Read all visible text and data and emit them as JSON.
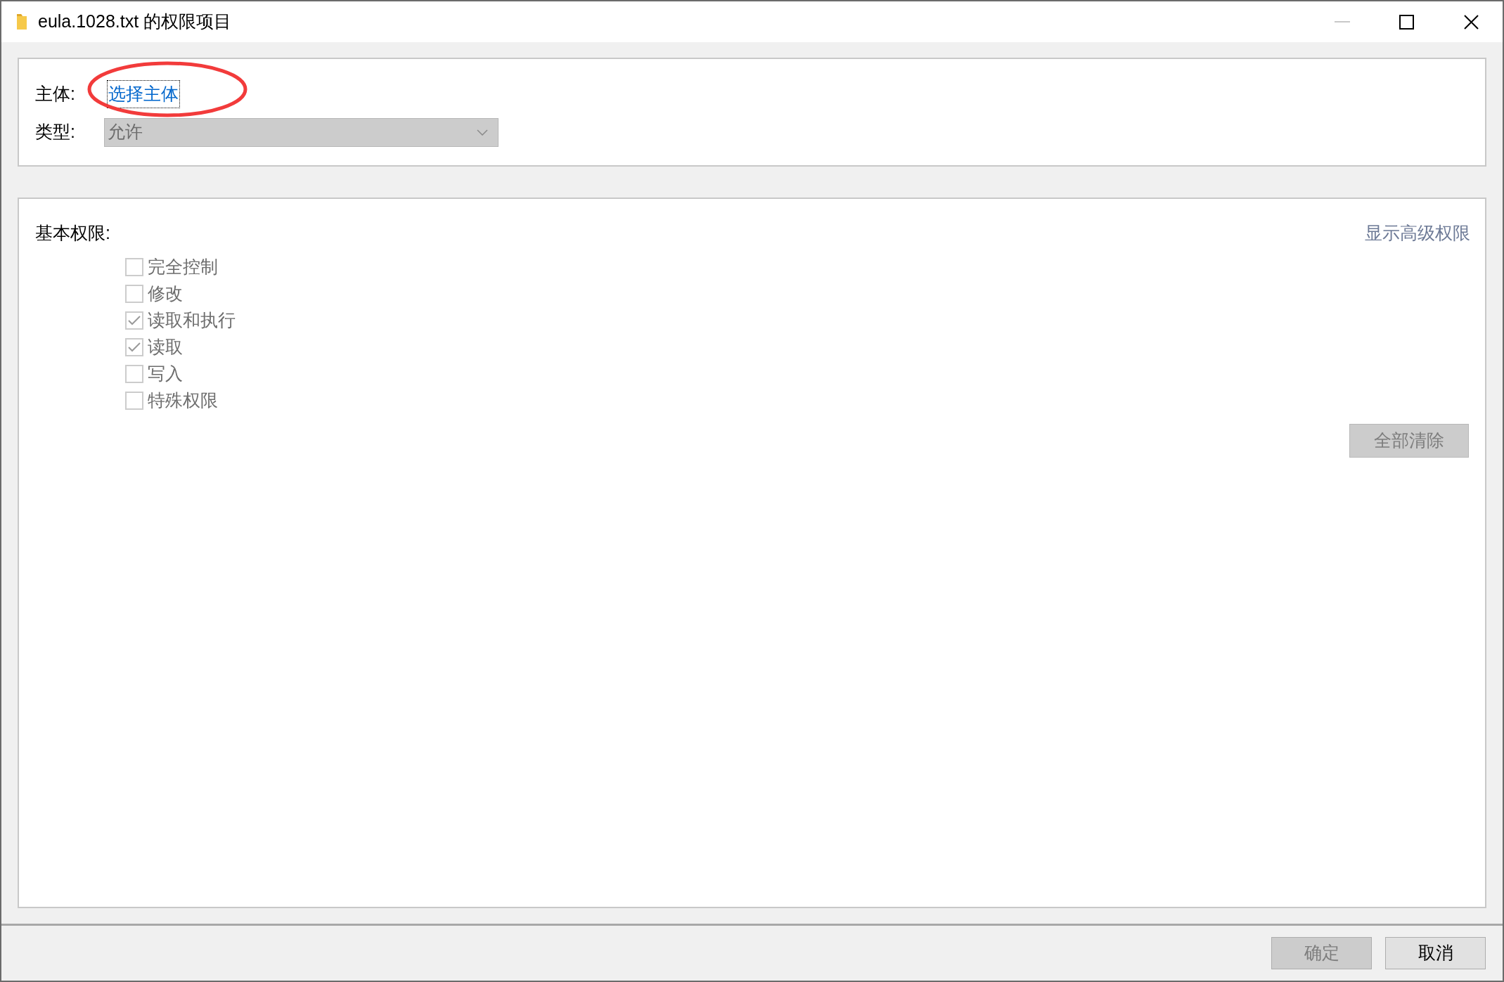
{
  "window": {
    "title": "eula.1028.txt 的权限项目"
  },
  "principal": {
    "label": "主体:",
    "link": "选择主体",
    "focused": true,
    "annotated": true
  },
  "type": {
    "label": "类型:",
    "value": "允许",
    "disabled": true
  },
  "basic_permissions": {
    "heading": "基本权限:",
    "show_advanced": "显示高级权限",
    "items": [
      {
        "label": "完全控制",
        "checked": false,
        "disabled": true
      },
      {
        "label": "修改",
        "checked": false,
        "disabled": true
      },
      {
        "label": "读取和执行",
        "checked": true,
        "disabled": true
      },
      {
        "label": "读取",
        "checked": true,
        "disabled": true
      },
      {
        "label": "写入",
        "checked": false,
        "disabled": true
      },
      {
        "label": "特殊权限",
        "checked": false,
        "disabled": true
      }
    ],
    "clear_all": {
      "label": "全部清除",
      "disabled": true
    }
  },
  "buttons": [
    {
      "label": "确定",
      "disabled": true
    },
    {
      "label": "取消",
      "disabled": false
    }
  ]
}
